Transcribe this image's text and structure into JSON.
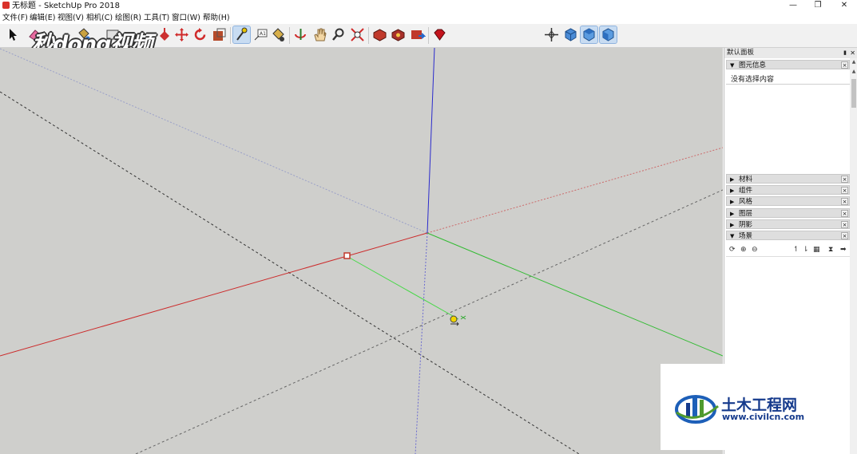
{
  "window": {
    "title": "无标题 - SketchUp Pro 2018",
    "controls": {
      "minimize": "—",
      "restore": "❐",
      "close": "✕"
    }
  },
  "menu": [
    {
      "id": "file",
      "label": "文件(F)"
    },
    {
      "id": "edit",
      "label": "编辑(E)"
    },
    {
      "id": "view",
      "label": "视图(V)"
    },
    {
      "id": "camera",
      "label": "相机(C)"
    },
    {
      "id": "draw",
      "label": "绘图(R)"
    },
    {
      "id": "tools",
      "label": "工具(T)"
    },
    {
      "id": "window",
      "label": "窗口(W)"
    },
    {
      "id": "help",
      "label": "帮助(H)"
    }
  ],
  "toolbar": {
    "tools": [
      {
        "id": "select",
        "icon": "arrow-select-icon"
      },
      {
        "id": "eraser",
        "icon": "eraser-icon"
      },
      {
        "id": "paint",
        "icon": "paint-bucket-icon"
      },
      {
        "id": "rectangle",
        "icon": "rectangle-icon"
      },
      {
        "id": "push-pull",
        "icon": "push-pull-icon"
      },
      {
        "id": "move",
        "icon": "move-icon"
      },
      {
        "id": "rotate",
        "icon": "rotate-icon"
      },
      {
        "id": "scale",
        "icon": "scale-icon"
      },
      {
        "id": "tape-measure",
        "icon": "tape-measure-icon",
        "active": true
      },
      {
        "id": "text",
        "icon": "text-label-icon"
      },
      {
        "id": "paint-bucket",
        "icon": "paint-bucket-icon"
      },
      {
        "id": "orbit",
        "icon": "orbit-icon"
      },
      {
        "id": "pan",
        "icon": "pan-hand-icon"
      },
      {
        "id": "zoom",
        "icon": "zoom-icon"
      },
      {
        "id": "zoom-extents",
        "icon": "zoom-extents-icon"
      },
      {
        "id": "warehouse",
        "icon": "3d-warehouse-icon"
      },
      {
        "id": "extension-warehouse",
        "icon": "extension-warehouse-icon"
      },
      {
        "id": "share-model",
        "icon": "share-model-icon"
      },
      {
        "id": "ruby",
        "icon": "ruby-gem-icon"
      },
      {
        "id": "position-camera",
        "icon": "position-camera-icon"
      },
      {
        "id": "view-iso",
        "icon": "iso-cube-icon"
      },
      {
        "id": "view-top",
        "icon": "top-cube-icon"
      },
      {
        "id": "view-front",
        "icon": "front-cube-icon"
      }
    ]
  },
  "watermark": {
    "text": "秒dong视频"
  },
  "viewport": {
    "background": "#cfcfcc",
    "axis_colors": {
      "red": "#cc2b2b",
      "green": "#33bb33",
      "blue": "#2b2bcc"
    }
  },
  "tray": {
    "title": "默认面板",
    "entity_info": {
      "label": "图元信息",
      "empty_message": "没有选择内容"
    },
    "sections": [
      {
        "label": "材料",
        "expanded": false
      },
      {
        "label": "组件",
        "expanded": false
      },
      {
        "label": "风格",
        "expanded": false
      },
      {
        "label": "图层",
        "expanded": false
      },
      {
        "label": "阴影",
        "expanded": false
      },
      {
        "label": "场景",
        "expanded": true
      }
    ]
  },
  "logo": {
    "title": "土木工程网",
    "url": "www.civilcn.com"
  }
}
